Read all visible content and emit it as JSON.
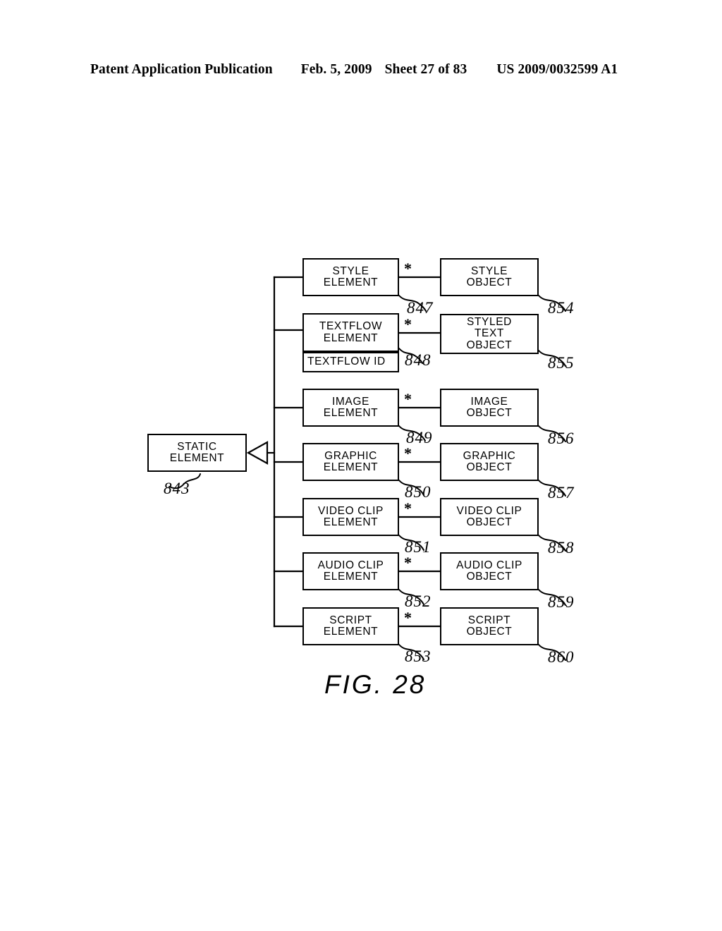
{
  "header": {
    "publication": "Patent Application Publication",
    "date": "Feb. 5, 2009",
    "sheet": "Sheet 27 of 83",
    "patent_number": "US 2009/0032599 A1"
  },
  "figure": {
    "caption": "FIG. 28",
    "base_node": {
      "label": "STATIC\nELEMENT",
      "ref": "843"
    },
    "multiplicity_symbol": "*",
    "rows": [
      {
        "element": {
          "label": "STYLE\nELEMENT",
          "ref": "847"
        },
        "object": {
          "label": "STYLE\nOBJECT",
          "ref": "854"
        }
      },
      {
        "element": {
          "label": "TEXTFLOW\nELEMENT",
          "ref": "848",
          "compartment": "TEXTFLOW ID"
        },
        "object": {
          "label": "STYLED\nTEXT\nOBJECT",
          "ref": "855"
        }
      },
      {
        "element": {
          "label": "IMAGE\nELEMENT",
          "ref": "849"
        },
        "object": {
          "label": "IMAGE\nOBJECT",
          "ref": "856"
        }
      },
      {
        "element": {
          "label": "GRAPHIC\nELEMENT",
          "ref": "850"
        },
        "object": {
          "label": "GRAPHIC\nOBJECT",
          "ref": "857"
        }
      },
      {
        "element": {
          "label": "VIDEO CLIP\nELEMENT",
          "ref": "851"
        },
        "object": {
          "label": "VIDEO CLIP\nOBJECT",
          "ref": "858"
        }
      },
      {
        "element": {
          "label": "AUDIO CLIP\nELEMENT",
          "ref": "852"
        },
        "object": {
          "label": "AUDIO CLIP\nOBJECT",
          "ref": "859"
        }
      },
      {
        "element": {
          "label": "SCRIPT\nELEMENT",
          "ref": "853"
        },
        "object": {
          "label": "SCRIPT\nOBJECT",
          "ref": "860"
        }
      }
    ]
  },
  "colors": {
    "ink": "#000000",
    "paper": "#ffffff"
  }
}
